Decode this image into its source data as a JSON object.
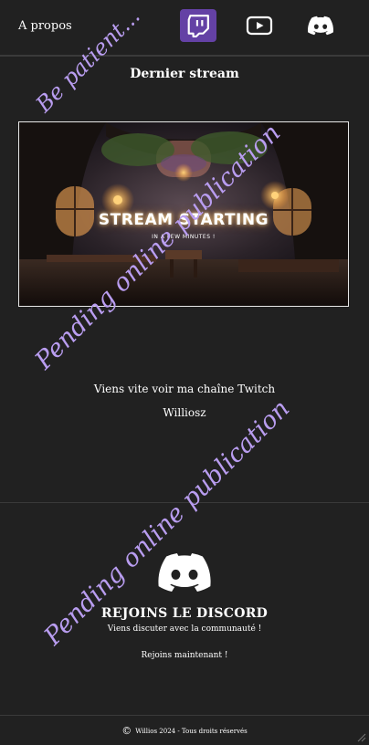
{
  "nav": {
    "about_label": "A propos",
    "icons": [
      "twitch-icon",
      "youtube-icon",
      "discord-icon"
    ],
    "twitch_color": "#6441a5"
  },
  "stream": {
    "title": "Dernier stream",
    "thumbnail_text": "STREAM STARTING",
    "thumbnail_subtext": "IN A FEW MINUTES !"
  },
  "cta": {
    "line": "Viens vite voir ma chaîne Twitch",
    "name": "Williosz"
  },
  "discord": {
    "title": "REJOINS LE DISCORD",
    "subtitle": "Viens discuter avec la communauté !",
    "join": "Rejoins maintenant !"
  },
  "footer": {
    "text": "Willios 2024 - Tous droits réservés"
  },
  "watermarks": {
    "top": "Be patient...",
    "middle": "Pending online publication",
    "bottom": "Pending online publication"
  },
  "colors": {
    "background": "#212121",
    "watermark": "#b99df0"
  }
}
